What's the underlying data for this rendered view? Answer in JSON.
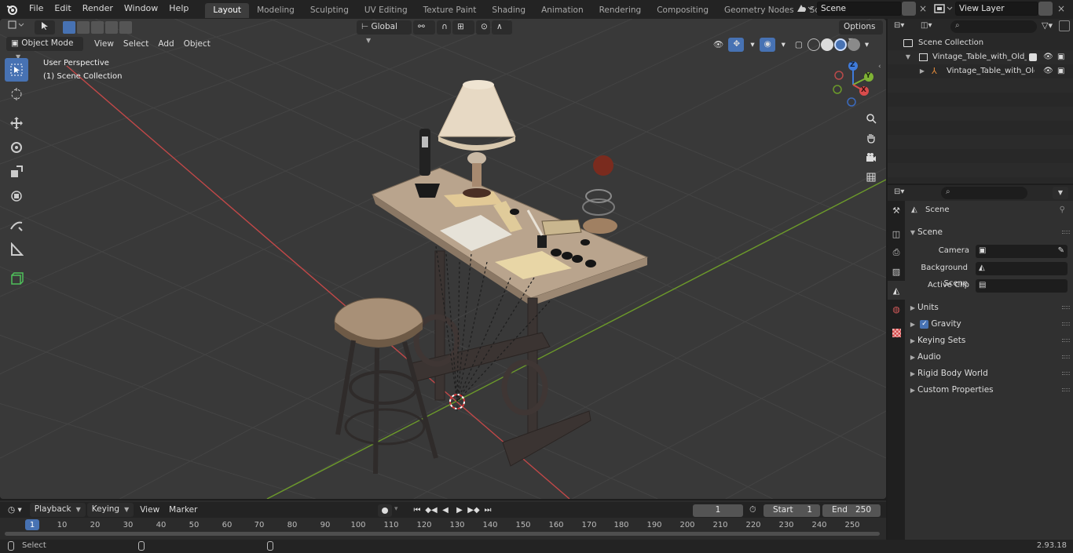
{
  "menus": [
    "File",
    "Edit",
    "Render",
    "Window",
    "Help"
  ],
  "workspaces": [
    "Layout",
    "Modeling",
    "Sculpting",
    "UV Editing",
    "Texture Paint",
    "Shading",
    "Animation",
    "Rendering",
    "Compositing",
    "Geometry Nodes",
    "Scripting"
  ],
  "scene_name": "Scene",
  "view_layer": "View Layer",
  "viewport": {
    "mode": "Object Mode",
    "menu": [
      "View",
      "Select",
      "Add",
      "Object"
    ],
    "transform_orientation": "Global",
    "options_label": "Options",
    "perspective": "User Perspective",
    "collection": "(1) Scene Collection",
    "gizmo_axes": {
      "x": "X",
      "y": "Y",
      "z": "Z"
    }
  },
  "timeline": {
    "menu": [
      "Playback",
      "Keying",
      "View",
      "Marker"
    ],
    "current_frame": "1",
    "start_label": "Start",
    "start": "1",
    "end_label": "End",
    "end": "250",
    "ruler": [
      "1",
      "10",
      "20",
      "30",
      "40",
      "50",
      "60",
      "70",
      "80",
      "90",
      "100",
      "110",
      "120",
      "130",
      "140",
      "150",
      "160",
      "170",
      "180",
      "190",
      "200",
      "210",
      "220",
      "230",
      "240",
      "250"
    ]
  },
  "status": {
    "select": "Select",
    "version": "2.93.18"
  },
  "outliner": {
    "root": "Scene Collection",
    "collection": "Vintage_Table_with_Old_Stuff",
    "object": "Vintage_Table_with_Old_"
  },
  "properties": {
    "context": "Scene",
    "panel_scene": "Scene",
    "camera_label": "Camera",
    "background_label": "Background Scene",
    "clip_label": "Active Clip",
    "panels": [
      "Units",
      "Gravity",
      "Keying Sets",
      "Audio",
      "Rigid Body World",
      "Custom Properties"
    ]
  },
  "colors": {
    "accent": "#4772b3",
    "x_axis": "#d94c4c",
    "y_axis": "#7fb335",
    "z_axis": "#3f7bdb"
  }
}
